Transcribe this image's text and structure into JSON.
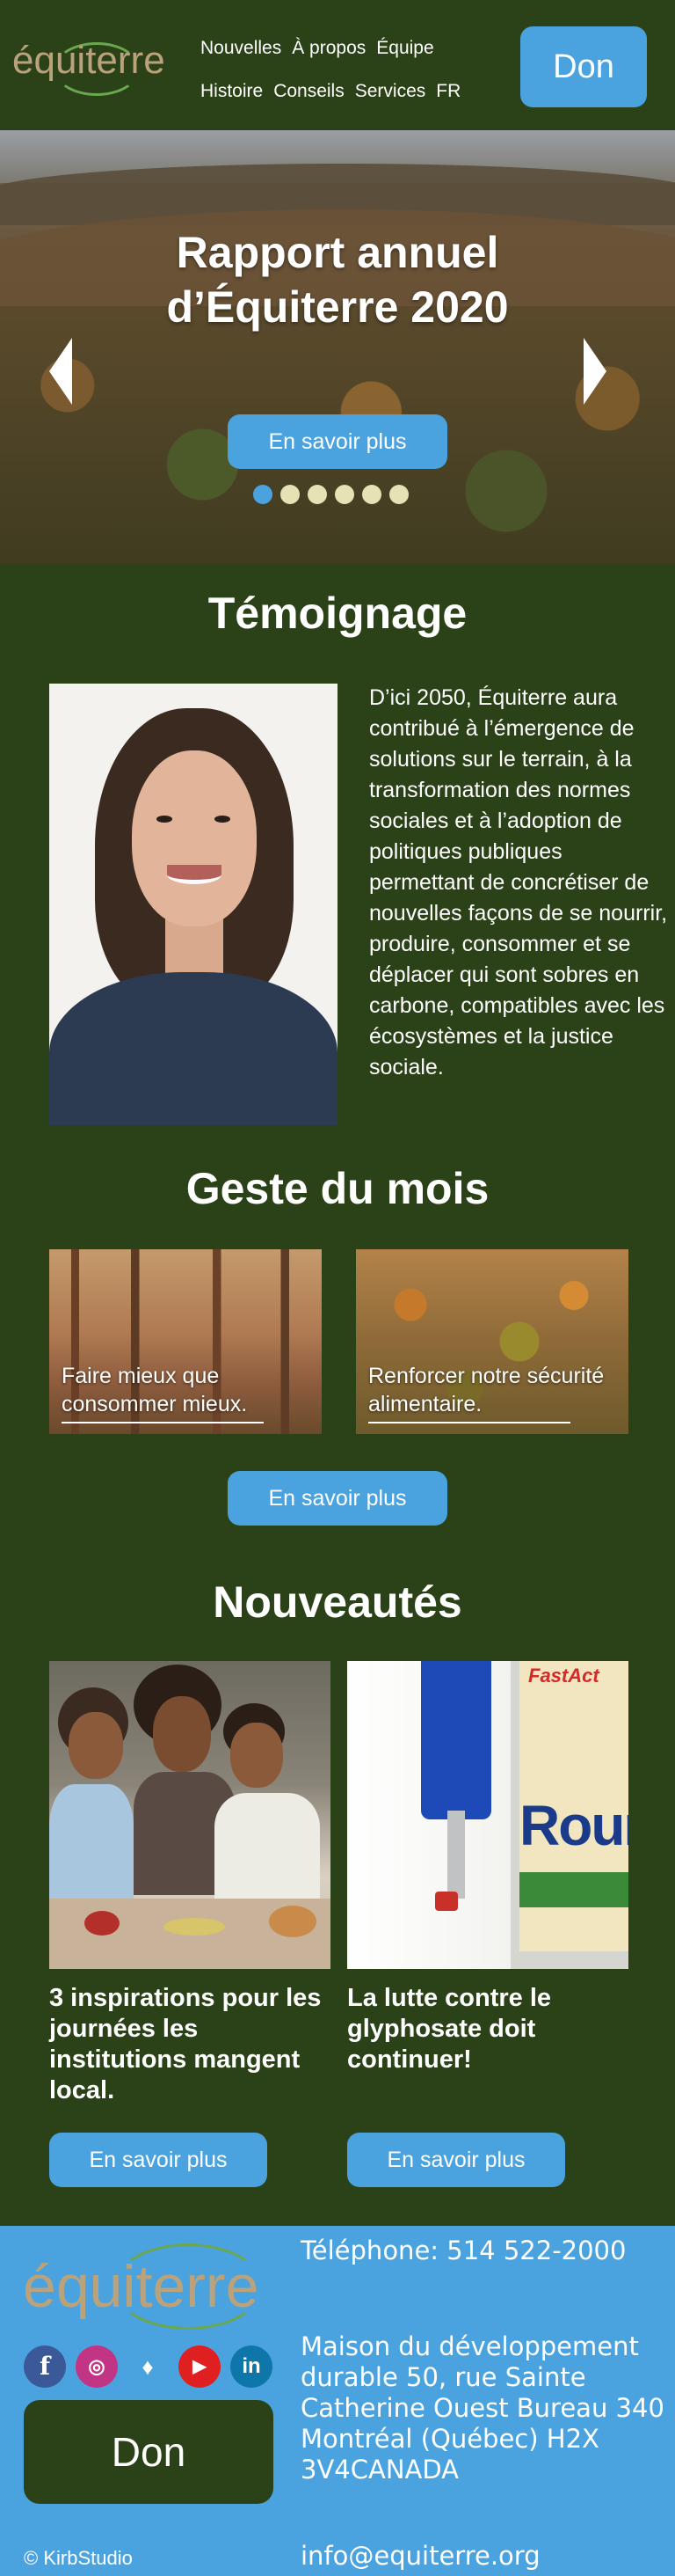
{
  "header": {
    "logo_text": "équiterre",
    "nav_row_1": [
      "Nouvelles",
      "À propos",
      "Équipe"
    ],
    "nav_row_2": [
      "Histoire",
      "Conseils",
      "Services",
      "FR"
    ],
    "don_label": "Don"
  },
  "hero": {
    "title": "Rapport annuel d’Équiterre 2020",
    "button_label": "En savoir plus",
    "slide_count": 6,
    "active_slide": 1
  },
  "temoignage": {
    "title": "Témoignage",
    "text": "D’ici 2050, Équiterre aura contribué à l’émergence de solutions sur le terrain, à la transformation des normes sociales et à l’adoption de politiques publiques permettant de concrétiser de nouvelles façons de se nourrir, produire, consommer et se déplacer qui sont sobres en carbone, compatibles avec les écosystèmes et la justice sociale."
  },
  "geste": {
    "title": "Geste du mois",
    "cards": [
      {
        "label": "Faire mieux que consommer mieux."
      },
      {
        "label": "Renforcer notre sécurité alimentaire."
      }
    ],
    "button_label": "En savoir plus"
  },
  "nouveautes": {
    "title": "Nouveautés",
    "items": [
      {
        "title": "3 inspirations pour les journées les institutions mangent local.",
        "button_label": "En savoir plus"
      },
      {
        "title": "La lutte contre le glyphosate doit continuer!",
        "button_label": "En savoir plus",
        "product_brand": "FastAct",
        "product_name": "Round"
      }
    ]
  },
  "footer": {
    "logo_text": "équiterre",
    "social": [
      "facebook-icon",
      "instagram-icon",
      "twitter-icon",
      "youtube-icon",
      "linkedin-icon"
    ],
    "don_label": "Don",
    "credit": "© KirbStudio",
    "phone": "Téléphone: 514 522-2000",
    "address": "Maison du développement durable 50, rue Sainte Catherine Ouest Bureau 340 Montréal (Québec) H2X 3V4CANADA",
    "email": "info@equiterre.org"
  },
  "colors": {
    "background_green": "#2b4218",
    "accent_blue": "#4aa3df",
    "logo_tan": "#b9a27c",
    "logo_arc_green": "#6aa84f"
  }
}
